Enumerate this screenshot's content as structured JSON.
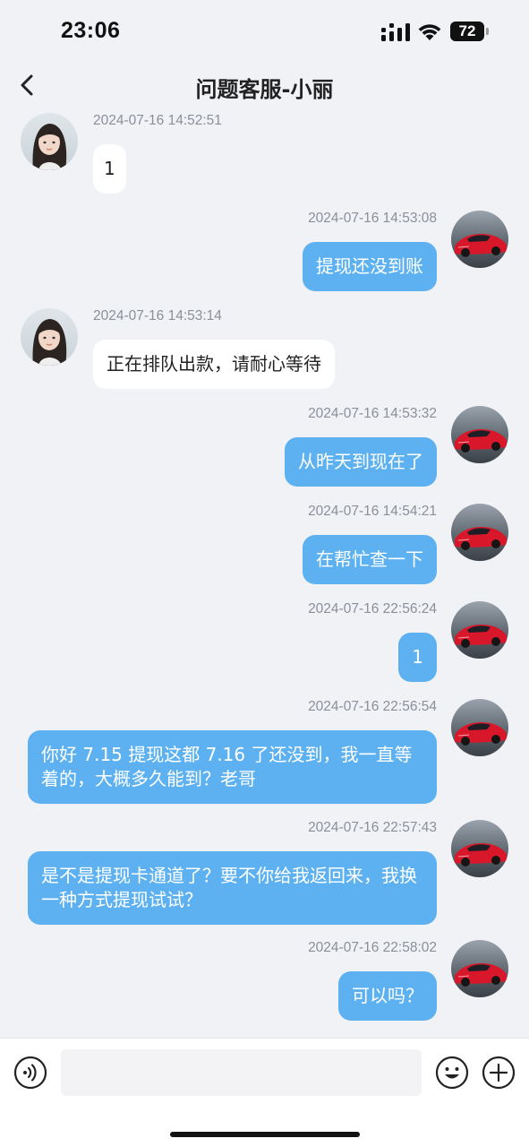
{
  "status_bar": {
    "time": "23:06",
    "battery": "72",
    "icons": [
      "signal-icon",
      "wifi-icon",
      "battery-icon"
    ]
  },
  "header": {
    "title": "问题客服-小丽",
    "back_icon": "chevron-left-icon"
  },
  "messages": [
    {
      "side": "left",
      "time": "2024-07-16 14:52:51",
      "text": "1"
    },
    {
      "side": "right",
      "time": "2024-07-16 14:53:08",
      "text": "提现还没到账"
    },
    {
      "side": "left",
      "time": "2024-07-16 14:53:14",
      "text": "正在排队出款，请耐心等待"
    },
    {
      "side": "right",
      "time": "2024-07-16 14:53:32",
      "text": "从昨天到现在了"
    },
    {
      "side": "right",
      "time": "2024-07-16 14:54:21",
      "text": "在帮忙查一下"
    },
    {
      "side": "right",
      "time": "2024-07-16 22:56:24",
      "text": "1"
    },
    {
      "side": "right",
      "time": "2024-07-16 22:56:54",
      "text": "你好 7.15 提现这都 7.16 了还没到，我一直等着的，大概多久能到？老哥"
    },
    {
      "side": "right",
      "time": "2024-07-16 22:57:43",
      "text": "是不是提现卡通道了？要不你给我返回来，我换一种方式提现试试？"
    },
    {
      "side": "right",
      "time": "2024-07-16 22:58:02",
      "text": "可以吗？"
    }
  ],
  "input_bar": {
    "placeholder": "",
    "icons": [
      "voice-icon",
      "emoji-icon",
      "plus-icon"
    ]
  },
  "colors": {
    "background": "#f1f2f6",
    "outgoing_bubble": "#5db1f0",
    "incoming_bubble": "#ffffff",
    "timestamp": "#8b8f99"
  }
}
